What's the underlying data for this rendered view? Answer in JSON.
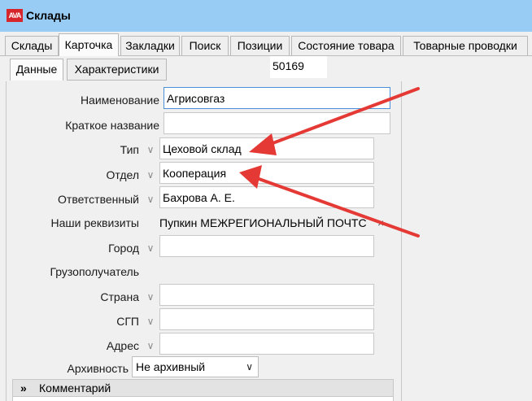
{
  "window": {
    "title": "Склады",
    "app_logo": "AVA"
  },
  "tabs": [
    "Склады",
    "Карточка",
    "Закладки",
    "Поиск",
    "Позиции",
    "Состояние товара",
    "Товарные проводки"
  ],
  "subtabs": [
    "Данные",
    "Характеристики"
  ],
  "record_number": "50169",
  "form": {
    "name": {
      "label": "Наименование",
      "value": "Агрисовгаз"
    },
    "short_name": {
      "label": "Краткое название",
      "value": ""
    },
    "type": {
      "label": "Тип",
      "value": "Цеховой склад"
    },
    "department": {
      "label": "Отдел",
      "value": "Кооперация"
    },
    "responsible": {
      "label": "Ответственный",
      "value": "Бахрова А. Е."
    },
    "requisites": {
      "label": "Наши реквизиты",
      "value": "Пупкин МЕЖРЕГИОНАЛЬНЫЙ ПОЧТС",
      "clear": "×"
    },
    "city": {
      "label": "Город",
      "value": ""
    },
    "consignee": {
      "label": "Грузополучатель"
    },
    "country": {
      "label": "Страна",
      "value": ""
    },
    "sgp": {
      "label": "СГП",
      "value": ""
    },
    "address": {
      "label": "Адрес",
      "value": ""
    },
    "archive": {
      "label": "Архивность",
      "value": "Не архивный"
    }
  },
  "comment_section": {
    "label": "Комментарий"
  },
  "annotation_color": "#e53935"
}
